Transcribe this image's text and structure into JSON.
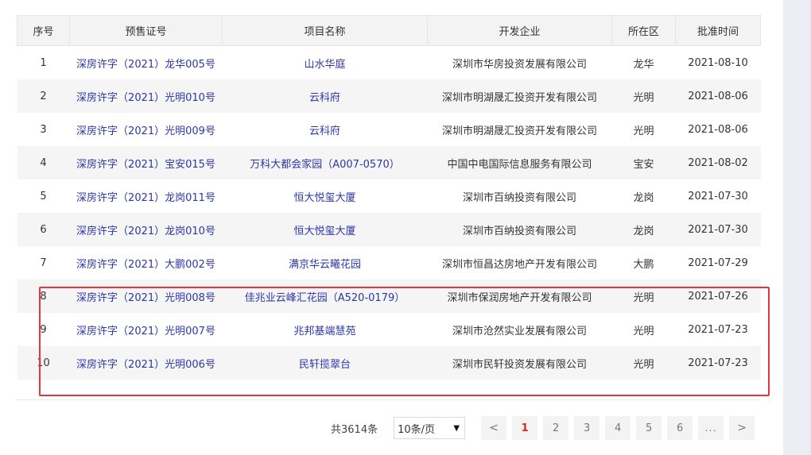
{
  "table": {
    "headers": [
      "序号",
      "预售证号",
      "项目名称",
      "开发企业",
      "所在区",
      "批准时间"
    ],
    "rows": [
      {
        "no": "1",
        "permit": "深房许字（2021）龙华005号",
        "project": "山水华庭",
        "developer": "深圳市华房投资发展有限公司",
        "district": "龙华",
        "date": "2021-08-10"
      },
      {
        "no": "2",
        "permit": "深房许字（2021）光明010号",
        "project": "云科府",
        "developer": "深圳市明湖晟汇投资开发有限公司",
        "district": "光明",
        "date": "2021-08-06"
      },
      {
        "no": "3",
        "permit": "深房许字（2021）光明009号",
        "project": "云科府",
        "developer": "深圳市明湖晟汇投资开发有限公司",
        "district": "光明",
        "date": "2021-08-06"
      },
      {
        "no": "4",
        "permit": "深房许字（2021）宝安015号",
        "project": "万科大都会家园（A007-0570）",
        "developer": "中国中电国际信息服务有限公司",
        "district": "宝安",
        "date": "2021-08-02"
      },
      {
        "no": "5",
        "permit": "深房许字（2021）龙岗011号",
        "project": "恒大悦玺大厦",
        "developer": "深圳市百纳投资有限公司",
        "district": "龙岗",
        "date": "2021-07-30"
      },
      {
        "no": "6",
        "permit": "深房许字（2021）龙岗010号",
        "project": "恒大悦玺大厦",
        "developer": "深圳市百纳投资有限公司",
        "district": "龙岗",
        "date": "2021-07-30"
      },
      {
        "no": "7",
        "permit": "深房许字（2021）大鹏002号",
        "project": "满京华云曦花园",
        "developer": "深圳市恒昌达房地产开发有限公司",
        "district": "大鹏",
        "date": "2021-07-29"
      },
      {
        "no": "8",
        "permit": "深房许字（2021）光明008号",
        "project": "佳兆业云峰汇花园（A520-0179）",
        "developer": "深圳市保润房地产开发有限公司",
        "district": "光明",
        "date": "2021-07-26"
      },
      {
        "no": "9",
        "permit": "深房许字（2021）光明007号",
        "project": "兆邦基端慧苑",
        "developer": "深圳市沧然实业发展有限公司",
        "district": "光明",
        "date": "2021-07-23"
      },
      {
        "no": "10",
        "permit": "深房许字（2021）光明006号",
        "project": "民轩揽翠台",
        "developer": "深圳市民轩投资发展有限公司",
        "district": "光明",
        "date": "2021-07-23"
      }
    ]
  },
  "pagination": {
    "total": "共3614条",
    "page_size": "10条/页",
    "prev": "<",
    "next": ">",
    "ellipsis": "...",
    "pages": [
      "1",
      "2",
      "3",
      "4",
      "5",
      "6"
    ],
    "active_page": "1"
  },
  "colors": {
    "link": "#2d36a8",
    "highlight_border": "#e8343b",
    "active_page": "#e1251b"
  }
}
